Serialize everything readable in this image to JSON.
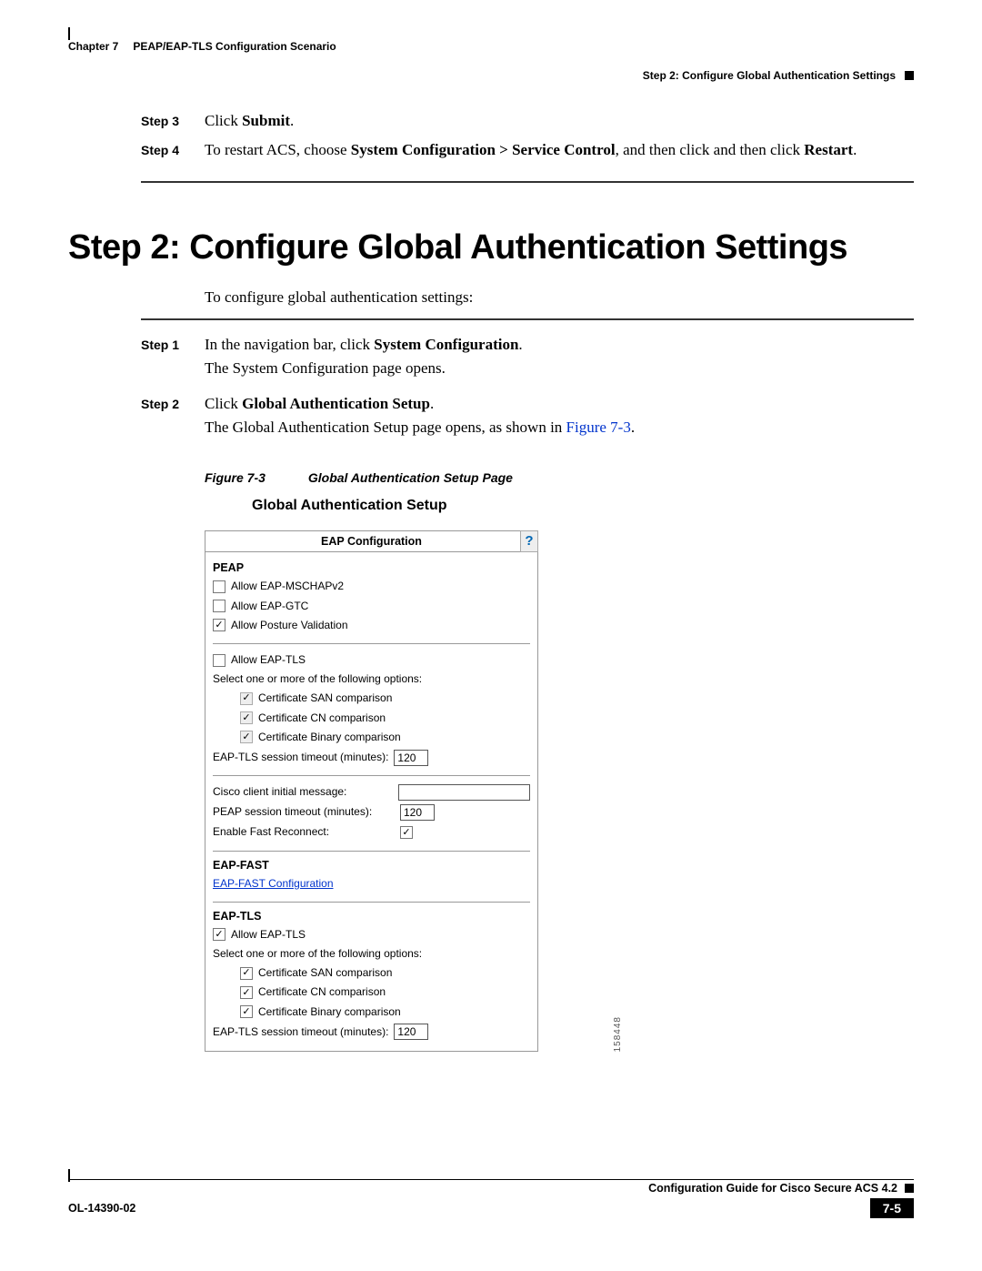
{
  "header": {
    "chapter": "Chapter 7",
    "section": "PEAP/EAP-TLS Configuration Scenario",
    "subsection": "Step 2: Configure Global Authentication Settings"
  },
  "upper_steps": {
    "s3": {
      "label": "Step 3",
      "pre": "Click ",
      "bold": "Submit",
      "post": "."
    },
    "s4": {
      "label": "Step 4",
      "pre": "To restart ACS, choose ",
      "bold1": "System Configuration > Service Control",
      "mid": ", and then click and then click ",
      "bold2": "Restart",
      "post": "."
    }
  },
  "heading": "Step 2: Configure Global Authentication Settings",
  "intro": "To configure global authentication settings:",
  "lower_steps": {
    "s1": {
      "label": "Step 1",
      "line1_pre": "In the navigation bar, click ",
      "line1_bold": "System Configuration",
      "line1_post": ".",
      "line2": "The System Configuration page opens."
    },
    "s2": {
      "label": "Step 2",
      "line1_pre": "Click ",
      "line1_bold": "Global Authentication Setup",
      "line1_post": ".",
      "line2_pre": "The Global Authentication Setup page opens, as shown in ",
      "line2_xref": "Figure 7-3",
      "line2_post": "."
    }
  },
  "figure": {
    "label": "Figure 7-3",
    "caption": "Global Authentication Setup Page"
  },
  "panel": {
    "title": "Global Authentication Setup",
    "header": "EAP Configuration",
    "help": "?",
    "peap": {
      "title": "PEAP",
      "allow_mschap": {
        "label": "Allow EAP-MSCHAPv2",
        "checked": false
      },
      "allow_gtc": {
        "label": "Allow EAP-GTC",
        "checked": false
      },
      "allow_posture": {
        "label": "Allow Posture Validation",
        "checked": true
      },
      "allow_tls": {
        "label": "Allow EAP-TLS",
        "checked": false
      },
      "select_note": "Select one or more of the following options:",
      "san": {
        "label": "Certificate SAN comparison",
        "checked": true,
        "disabled": true
      },
      "cn": {
        "label": "Certificate CN comparison",
        "checked": true,
        "disabled": true
      },
      "bin": {
        "label": "Certificate Binary comparison",
        "checked": true,
        "disabled": true
      },
      "timeout_label": "EAP-TLS session timeout (minutes):",
      "timeout_value": "120",
      "cisco_msg_label": "Cisco client initial message:",
      "cisco_msg_value": "",
      "peap_timeout_label": "PEAP session timeout (minutes):",
      "peap_timeout_value": "120",
      "fast_reconnect_label": "Enable Fast Reconnect:",
      "fast_reconnect_checked": true
    },
    "eapfast": {
      "title": "EAP-FAST",
      "link": "EAP-FAST Configuration"
    },
    "eaptls": {
      "title": "EAP-TLS",
      "allow": {
        "label": "Allow EAP-TLS",
        "checked": true
      },
      "select_note": "Select one or more of the following options:",
      "san": {
        "label": "Certificate SAN comparison",
        "checked": true
      },
      "cn": {
        "label": "Certificate CN comparison",
        "checked": true
      },
      "bin": {
        "label": "Certificate Binary comparison",
        "checked": true
      },
      "timeout_label": "EAP-TLS session timeout (minutes):",
      "timeout_value": "120"
    },
    "side_number": "158448"
  },
  "footer": {
    "guide": "Configuration Guide for Cisco Secure ACS 4.2",
    "docnum": "OL-14390-02",
    "pagenum": "7-5"
  }
}
